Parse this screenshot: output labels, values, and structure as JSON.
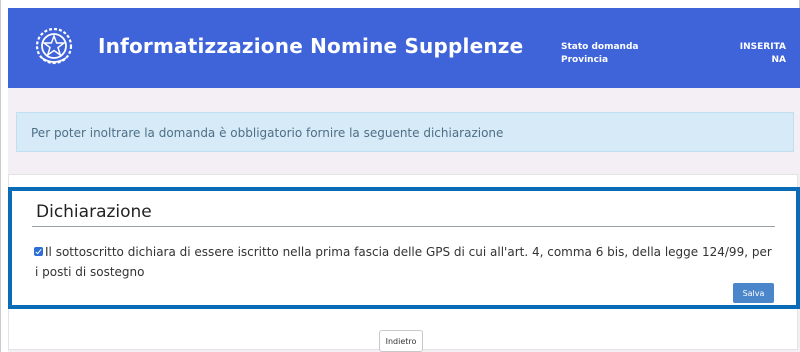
{
  "header": {
    "app_title": "Informatizzazione Nomine Supplenze",
    "logo_icon": "italian-republic-emblem-icon",
    "stato_domanda_label": "Stato domanda",
    "stato_domanda_value": "INSERITA",
    "provincia_label": "Provincia",
    "provincia_value": "NA"
  },
  "alert": {
    "text": "Per poter inoltrare la domanda è obbligatorio fornire la seguente dichiarazione"
  },
  "declaration": {
    "title": "Dichiarazione",
    "checkbox_checked": true,
    "text": "Il sottoscritto dichiara di essere iscritto nella prima fascia delle GPS di cui all'art. 4, comma 6 bis, della legge 124/99, per i posti di sostegno",
    "save_label": "Salva"
  },
  "footer": {
    "back_label": "Indietro"
  },
  "colors": {
    "header_bg": "#3f63d9",
    "alert_bg": "#d6eaf8",
    "highlight_border": "#0a6bb6",
    "save_button": "#4a86c9"
  }
}
